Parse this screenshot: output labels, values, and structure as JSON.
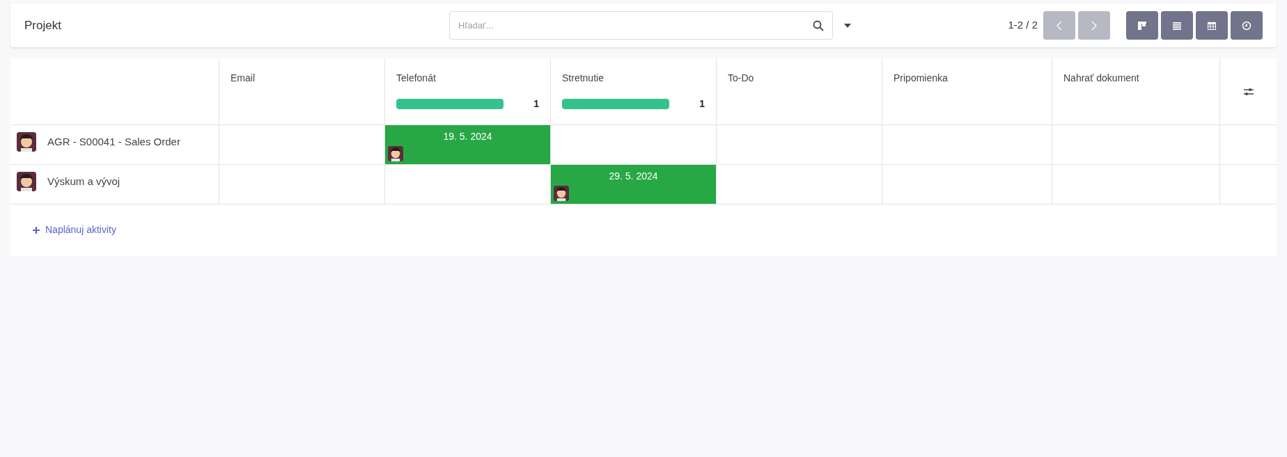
{
  "control_panel": {
    "title": "Projekt",
    "search": {
      "placeholder": "Hľadať..."
    },
    "pager": {
      "value": "1-2 / 2",
      "previous_disabled": true,
      "next_disabled": true
    }
  },
  "columns": [
    {
      "label": "Email"
    },
    {
      "label": "Telefonát",
      "progress": {
        "level": 1,
        "count": "1"
      }
    },
    {
      "label": "Stretnutie",
      "progress": {
        "level": 1,
        "count": "1"
      }
    },
    {
      "label": "To-Do"
    },
    {
      "label": "Pripomienka"
    },
    {
      "label": "Nahrať dokument"
    }
  ],
  "rows": [
    {
      "name": "AGR - S00041 - Sales Order",
      "cells": [
        {
          "kind": "empty"
        },
        {
          "kind": "activity",
          "date": "19. 5. 2024",
          "color": "#28a745"
        },
        {
          "kind": "empty"
        },
        {
          "kind": "empty"
        },
        {
          "kind": "empty"
        },
        {
          "kind": "empty"
        }
      ]
    },
    {
      "name": "Výskum a vývoj",
      "cells": [
        {
          "kind": "empty"
        },
        {
          "kind": "empty"
        },
        {
          "kind": "activity",
          "date": "29. 5. 2024",
          "color": "#28a745"
        },
        {
          "kind": "empty"
        },
        {
          "kind": "empty"
        },
        {
          "kind": "empty"
        }
      ]
    }
  ],
  "add_link": {
    "label": "Naplánuj aktivity"
  }
}
